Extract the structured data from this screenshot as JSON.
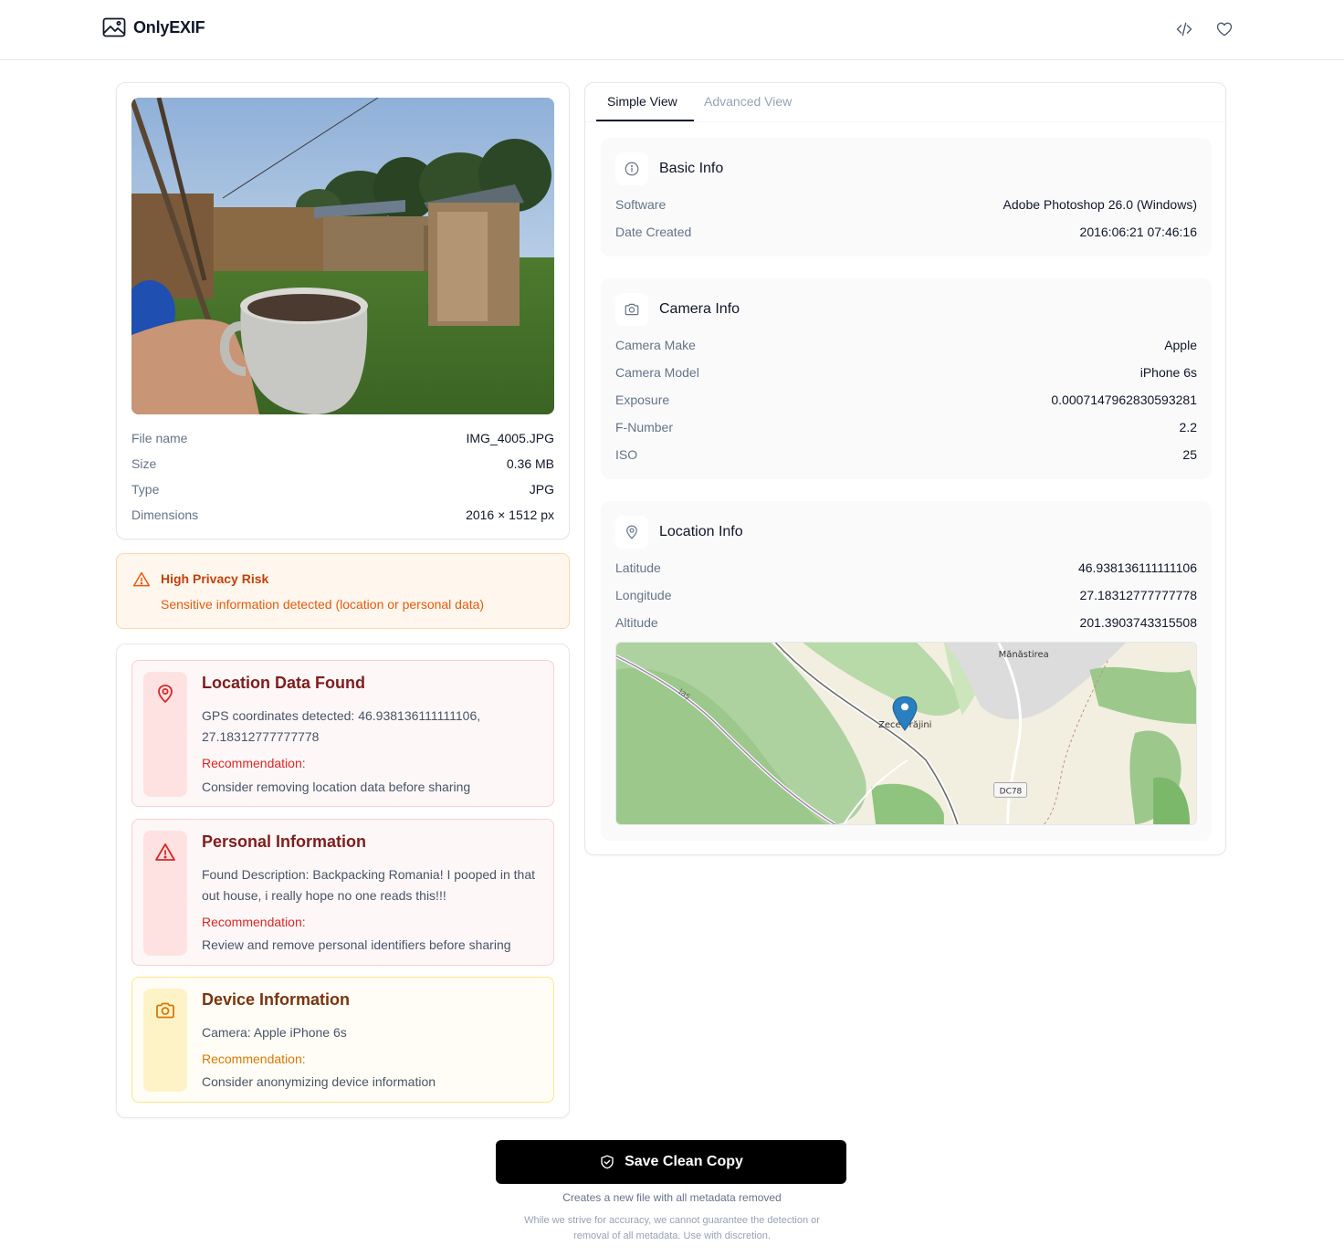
{
  "app": {
    "name": "OnlyEXIF"
  },
  "header": {
    "code_icon": "code-icon",
    "heart_icon": "heart-icon"
  },
  "file": {
    "rows": [
      {
        "label": "File name",
        "value": "IMG_4005.JPG"
      },
      {
        "label": "Size",
        "value": "0.36 MB"
      },
      {
        "label": "Type",
        "value": "JPG"
      },
      {
        "label": "Dimensions",
        "value": "2016 × 1512 px"
      }
    ]
  },
  "risk": {
    "title": "High Privacy Risk",
    "description": "Sensitive information detected (location or personal data)",
    "color": "#c2410c"
  },
  "findings": [
    {
      "icon": "map-pin-icon",
      "title": "Location Data Found",
      "description": "GPS coordinates detected: 46.938136111111106, 27.18312777777778",
      "recommendation_label": "Recommendation:",
      "recommendation": "Consider removing location data before sharing"
    },
    {
      "icon": "warning-icon",
      "title": "Personal Information",
      "description": "Found Description: Backpacking Romania! I pooped in that out house, i really hope no one reads this!!!",
      "recommendation_label": "Recommendation:",
      "recommendation": "Review and remove personal identifiers before sharing"
    },
    {
      "icon": "camera-icon",
      "title": "Device Information",
      "description": "Camera: Apple iPhone 6s",
      "recommendation_label": "Recommendation:",
      "recommendation": "Consider anonymizing device information"
    }
  ],
  "tabs": [
    {
      "label": "Simple View",
      "active": true
    },
    {
      "label": "Advanced View",
      "active": false
    }
  ],
  "sections": {
    "basic": {
      "title": "Basic Info",
      "rows": [
        {
          "label": "Software",
          "value": "Adobe Photoshop 26.0 (Windows)"
        },
        {
          "label": "Date Created",
          "value": "2016:06:21 07:46:16"
        }
      ]
    },
    "camera": {
      "title": "Camera Info",
      "rows": [
        {
          "label": "Camera Make",
          "value": "Apple"
        },
        {
          "label": "Camera Model",
          "value": "iPhone 6s"
        },
        {
          "label": "Exposure",
          "value": "0.0007147962830593281"
        },
        {
          "label": "F-Number",
          "value": "2.2"
        },
        {
          "label": "ISO",
          "value": "25"
        }
      ]
    },
    "location": {
      "title": "Location Info",
      "rows": [
        {
          "label": "Latitude",
          "value": "46.938136111111106"
        },
        {
          "label": "Longitude",
          "value": "27.18312777777778"
        },
        {
          "label": "Altitude",
          "value": "201.3903743315508"
        }
      ],
      "map": {
        "place_labels": [
          "Mănăstirea",
          "Zece Prăjini",
          "DC78"
        ],
        "road_label": "Iaș"
      }
    }
  },
  "actions": {
    "save_label": "Save Clean Copy",
    "save_subtitle": "Creates a new file with all metadata removed",
    "disclaimer": "While we strive for accuracy, we cannot guarantee the detection or removal of all metadata. Use with discretion."
  }
}
